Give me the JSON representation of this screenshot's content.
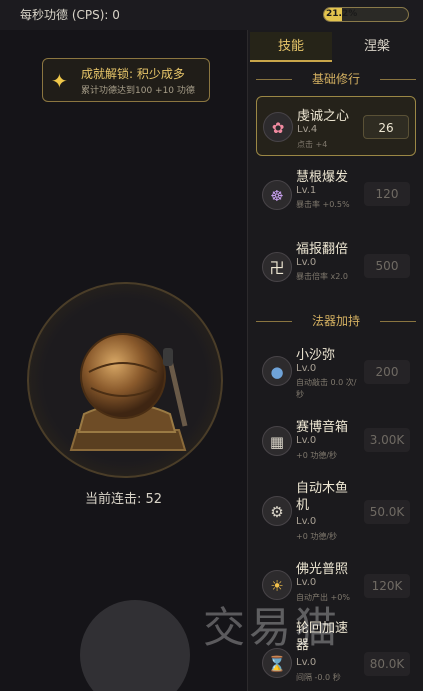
{
  "header": {
    "cps_label": "每秒功德 (CPS): 0",
    "progress_text": "21.2%",
    "progress_value": 0.212
  },
  "achievement": {
    "title": "成就解锁: 积少成多",
    "desc": "累计功德达到100 +10 功德",
    "icon": "sparkle-icon"
  },
  "drum": {
    "combo_text": "当前连击: 52"
  },
  "tabs": [
    {
      "label": "技能",
      "active": true
    },
    {
      "label": "涅槃",
      "active": false
    }
  ],
  "sections": {
    "basic": "基础修行",
    "artifacts": "法器加持"
  },
  "skills": [
    {
      "name": "虔诚之心",
      "level": "Lv.4",
      "desc": "点击 +4",
      "price": "26",
      "icon": "lotus-icon",
      "affordable": true
    },
    {
      "name": "慧根爆发",
      "level": "Lv.1",
      "desc": "暴击率 +0.5%",
      "price": "120",
      "icon": "dharma-wheel-icon",
      "affordable": false
    },
    {
      "name": "福报翻倍",
      "level": "Lv.0",
      "desc": "暴击倍率 x2.0",
      "price": "500",
      "icon": "swastika-icon",
      "affordable": false
    }
  ],
  "artifacts": [
    {
      "name": "小沙弥",
      "level": "Lv.0",
      "desc": "自动敲击 0.0 次/秒",
      "price": "200",
      "icon": "monk-icon"
    },
    {
      "name": "赛博音箱",
      "level": "Lv.0",
      "desc": "+0 功德/秒",
      "price": "3.00K",
      "icon": "speaker-icon"
    },
    {
      "name": "自动木鱼机",
      "level": "Lv.0",
      "desc": "+0 功德/秒",
      "price": "50.0K",
      "icon": "gear-icon"
    },
    {
      "name": "佛光普照",
      "level": "Lv.0",
      "desc": "自动产出 +0%",
      "price": "120K",
      "icon": "sun-icon"
    },
    {
      "name": "轮回加速器",
      "level": "Lv.0",
      "desc": "间隔 -0.0 秒",
      "price": "80.0K",
      "icon": "hourglass-icon"
    }
  ],
  "watermark": "交易猫",
  "colors": {
    "gold": "#e8c66a",
    "progress_fill": "#e3c44e",
    "background": "#17161a"
  }
}
